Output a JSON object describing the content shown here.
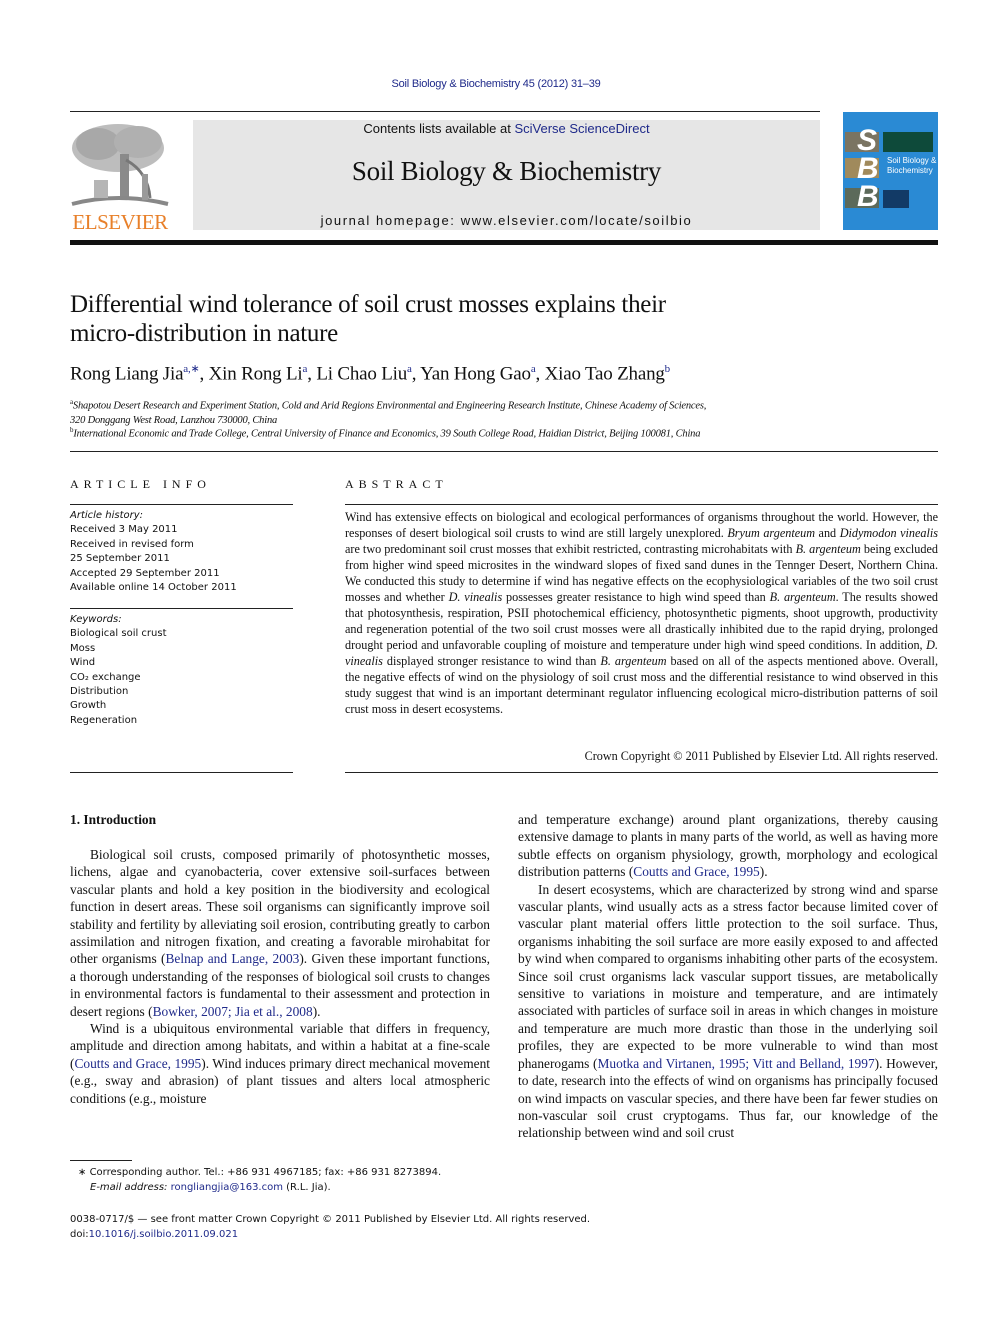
{
  "running_head": "Soil Biology & Biochemistry 45 (2012) 31–39",
  "header": {
    "publisher_logo_text": "ELSEVIER",
    "contents_prefix": "Contents lists available at ",
    "contents_link": "SciVerse ScienceDirect",
    "journal_title": "Soil Biology & Biochemistry",
    "homepage_prefix": "journal homepage: ",
    "homepage_url": "www.elsevier.com/locate/soilbio",
    "cover": {
      "letters": [
        "S",
        "B",
        "B"
      ],
      "title_line1": "Soil Biology &",
      "title_line2": "Biochemistry"
    },
    "colors": {
      "elsevier_orange": "#e8802a",
      "link_blue": "#1f2a8a",
      "banner_gray": "#e6e6e6",
      "cover_blue": "#2a8ad4"
    }
  },
  "article": {
    "title_line1": "Differential wind tolerance of soil crust mosses explains their",
    "title_line2": "micro-distribution in nature",
    "authors": [
      {
        "name": "Rong Liang Jia",
        "sup": "a,∗",
        "sep": ", "
      },
      {
        "name": "Xin Rong Li",
        "sup": "a",
        "sep": ", "
      },
      {
        "name": "Li Chao Liu",
        "sup": "a",
        "sep": ", "
      },
      {
        "name": "Yan Hong Gao",
        "sup": "a",
        "sep": ", "
      },
      {
        "name": "Xiao Tao Zhang",
        "sup": "b",
        "sep": ""
      }
    ],
    "affiliations": [
      {
        "mark": "a",
        "line1": "Shapotou Desert Research and Experiment Station, Cold and Arid Regions Environmental and Engineering Research Institute, Chinese Academy of Sciences,",
        "line2": "320 Donggang West Road, Lanzhou 730000, China"
      },
      {
        "mark": "b",
        "line1": "International Economic and Trade College, Central University of Finance and Economics, 39 South College Road, Haidian District, Beijing 100081, China",
        "line2": ""
      }
    ]
  },
  "article_info": {
    "heading": "ARTICLE INFO",
    "history_label": "Article history:",
    "history": [
      "Received 3 May 2011",
      "Received in revised form",
      "25 September 2011",
      "Accepted 29 September 2011",
      "Available online 14 October 2011"
    ],
    "keywords_label": "Keywords:",
    "keywords": [
      "Biological soil crust",
      "Moss",
      "Wind",
      "CO₂ exchange",
      "Distribution",
      "Growth",
      "Regeneration"
    ]
  },
  "abstract": {
    "heading": "ABSTRACT",
    "segments": [
      {
        "t": "Wind has extensive effects on biological and ecological performances of organisms throughout the world. However, the responses of desert biological soil crusts to wind are still largely unexplored. "
      },
      {
        "t": "Bryum argenteum",
        "i": true
      },
      {
        "t": " and "
      },
      {
        "t": "Didymodon vinealis",
        "i": true
      },
      {
        "t": " are two predominant soil crust mosses that exhibit restricted, contrasting microhabitats with "
      },
      {
        "t": "B. argenteum",
        "i": true
      },
      {
        "t": " being excluded from higher wind speed microsites in the windward slopes of fixed sand dunes in the Tennger Desert, Northern China. We conducted this study to determine if wind has negative effects on the ecophysiological variables of the two soil crust mosses and whether "
      },
      {
        "t": "D. vinealis",
        "i": true
      },
      {
        "t": " possesses greater resistance to high wind speed than "
      },
      {
        "t": "B. argenteum",
        "i": true
      },
      {
        "t": ". The results showed that photosynthesis, respiration, PSII photochemical efficiency, photosynthetic pigments, shoot upgrowth, productivity and regeneration potential of the two soil crust mosses were all drastically inhibited due to the rapid drying, prolonged drought period and unfavorable coupling of moisture and temperature under high wind speed conditions. In addition, "
      },
      {
        "t": "D. vinealis",
        "i": true
      },
      {
        "t": " displayed stronger resistance to wind than "
      },
      {
        "t": "B. argenteum",
        "i": true
      },
      {
        "t": " based on all of the aspects mentioned above. Overall, the negative effects of wind on the physiology of soil crust moss and the differential resistance to wind observed in this study suggest that wind is an important determinant regulator influencing ecological micro-distribution patterns of soil crust moss in desert ecosystems."
      }
    ],
    "copyright": "Crown Copyright © 2011 Published by Elsevier Ltd. All rights reserved."
  },
  "introduction": {
    "heading": "1.  Introduction",
    "left_paragraphs": [
      [
        {
          "t": "Biological soil crusts, composed primarily of photosynthetic mosses, lichens, algae and cyanobacteria, cover extensive soil-surfaces between vascular plants and hold a key position in the biodiversity and ecological function in desert areas. These soil organisms can significantly improve soil stability and fertility by alleviating soil erosion, contributing greatly to carbon assimilation and nitrogen fixation, and creating a favorable mirohabitat for other organisms ("
        },
        {
          "t": "Belnap and Lange, 2003",
          "ref": true
        },
        {
          "t": "). Given these important functions, a thorough understanding of the responses of biological soil crusts to changes in environmental factors is fundamental to their assessment and protection in desert regions ("
        },
        {
          "t": "Bowker, 2007; Jia et al., 2008",
          "ref": true
        },
        {
          "t": ")."
        }
      ],
      [
        {
          "t": "Wind is a ubiquitous environmental variable that differs in frequency, amplitude and direction among habitats, and within a habitat at a fine-scale ("
        },
        {
          "t": "Coutts and Grace, 1995",
          "ref": true
        },
        {
          "t": "). Wind induces primary direct mechanical movement (e.g., sway and abrasion) of plant tissues and alters local atmospheric conditions (e.g., moisture"
        }
      ]
    ],
    "right_paragraphs": [
      [
        {
          "t": "and temperature exchange) around plant organizations, thereby causing extensive damage to plants in many parts of the world, as well as having more subtle effects on organism physiology, growth, morphology and ecological distribution patterns ("
        },
        {
          "t": "Coutts and Grace, 1995",
          "ref": true
        },
        {
          "t": ")."
        }
      ],
      [
        {
          "t": "In desert ecosystems, which are characterized by strong wind and sparse vascular plants, wind usually acts as a stress factor because limited cover of vascular plant material offers little protection to the soil surface. Thus, organisms inhabiting the soil surface are more easily exposed to and affected by wind when compared to organisms inhabiting other parts of the ecosystem. Since soil crust organisms lack vascular support tissues, are metabolically sensitive to variations in moisture and temperature, and are intimately associated with particles of surface soil in areas in which changes in moisture and temperature are much more drastic than those in the underlying soil profiles, they are expected to be more vulnerable to wind than most phanerogams ("
        },
        {
          "t": "Muotka and Virtanen, 1995; Vitt and Belland, 1997",
          "ref": true
        },
        {
          "t": "). However, to date, research into the effects of wind on organisms has principally focused on wind impacts on vascular species, and there have been far fewer studies on non-vascular soil crust cryptogams. Thus far, our knowledge of the relationship between wind and soil crust"
        }
      ]
    ]
  },
  "footnote": {
    "mark": "∗",
    "corresponding": "Corresponding author. Tel.: +86 931 4967185; fax: +86 931 8273894.",
    "email_label": "E-mail address: ",
    "email": "rongliangjia@163.com",
    "email_suffix": " (R.L. Jia)."
  },
  "bottom": {
    "issn_line": "0038-0717/$ — see front matter Crown Copyright © 2011 Published by Elsevier Ltd. All rights reserved.",
    "doi_label": "doi:",
    "doi": "10.1016/j.soilbio.2011.09.021"
  }
}
